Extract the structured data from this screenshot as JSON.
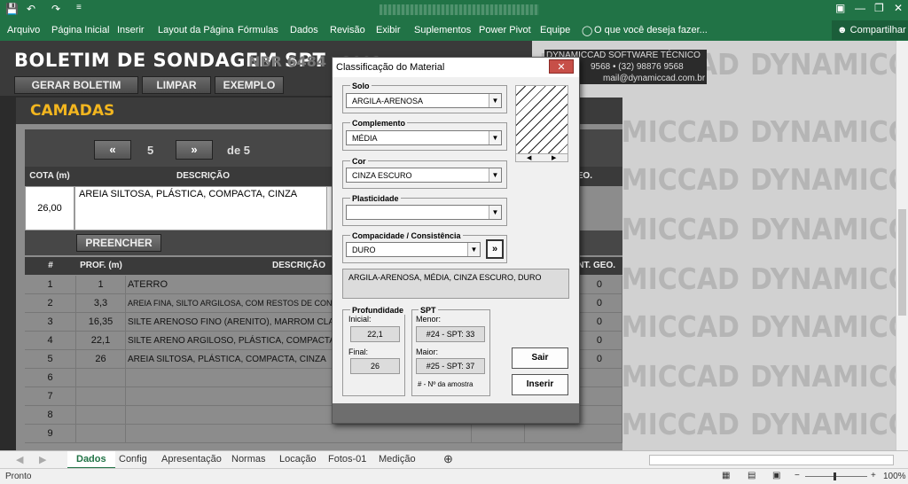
{
  "window": {
    "quick_access": [
      "💾",
      "↶",
      "↷",
      "≡"
    ],
    "controls": [
      "▣",
      "—",
      "❐",
      "✕"
    ]
  },
  "ribbon": {
    "tabs": [
      "Arquivo",
      "Página Inicial",
      "Inserir",
      "Layout da Página",
      "Fórmulas",
      "Dados",
      "Revisão",
      "Exibir",
      "Suplementos",
      "Power Pivot",
      "Equipe"
    ],
    "tell_me": "O que você deseja fazer...",
    "share": "Compartilhar"
  },
  "sheet": {
    "title": "BOLETIM DE SONDAGEM SPT",
    "norm": "NBR 6484 : 2001",
    "company_lines": [
      "DYNAMICCAD SOFTWARE TÉCNICO",
      "9568 • (32) 98876 9568",
      "mail@dynamiccad.com.br"
    ],
    "watermark": "DYNAMICCAD",
    "buttons": {
      "generate": "GERAR BOLETIM",
      "clear": "LIMPAR",
      "example": "EXEMPLO"
    },
    "section_title": "CAMADAS",
    "nav": {
      "prev": "«",
      "current": "5",
      "next": "»",
      "total": "de 5"
    },
    "entry_headers": {
      "cota": "COTA (m)",
      "descricao": "DESCRIÇÃO",
      "geo": "GEO."
    },
    "entry": {
      "cota": "26,00",
      "descricao": "AREIA SILTOSA, PLÁSTICA, COMPACTA, CINZA"
    },
    "fill_button": "PREENCHER",
    "table_headers": {
      "num": "#",
      "prof": "PROF. (m)",
      "descricao": "DESCRIÇÃO",
      "geo": "INT. GEO."
    },
    "rows": [
      {
        "num": "1",
        "prof": "1",
        "desc": "ATERRO",
        "geo": "0"
      },
      {
        "num": "2",
        "prof": "3,3",
        "desc": "AREIA FINA, SILTO ARGILOSA, COM RESTOS DE CONC",
        "geo": "0"
      },
      {
        "num": "3",
        "prof": "16,35",
        "desc": "SILTE ARENOSO FINO (ARENITO), MARROM CLA",
        "geo": "0"
      },
      {
        "num": "4",
        "prof": "22,1",
        "desc": "SILTE ARENO ARGILOSO, PLÁSTICA, COMPACTA",
        "geo": "0"
      },
      {
        "num": "5",
        "prof": "26",
        "desc": "AREIA SILTOSA, PLÁSTICA, COMPACTA, CINZA",
        "geo": "0"
      },
      {
        "num": "6",
        "prof": "",
        "desc": "",
        "geo": ""
      },
      {
        "num": "7",
        "prof": "",
        "desc": "",
        "geo": ""
      },
      {
        "num": "8",
        "prof": "",
        "desc": "",
        "geo": ""
      },
      {
        "num": "9",
        "prof": "",
        "desc": "",
        "geo": ""
      }
    ]
  },
  "dialog": {
    "title": "Classificação do Material",
    "close": "✕",
    "solo_label": "Solo",
    "solo_value": "ARGILA-ARENOSA",
    "complemento_label": "Complemento",
    "complemento_value": "MÉDIA",
    "cor_label": "Cor",
    "cor_value": "CINZA ESCURO",
    "plasticidade_label": "Plasticidade",
    "plasticidade_value": "",
    "compacidade_label": "Compacidade / Consistência",
    "compacidade_value": "DURO",
    "more_button": "»",
    "summary": "ARGILA-ARENOSA, MÉDIA, CINZA ESCURO, DURO",
    "profundidade_label": "Profundidade",
    "inicial_label": "Inicial:",
    "inicial_value": "22,1",
    "final_label": "Final:",
    "final_value": "26",
    "spt_label": "SPT",
    "menor_label": "Menor:",
    "menor_value": "#24 - SPT: 33",
    "maior_label": "Maior:",
    "maior_value": "#25 - SPT: 37",
    "spt_note": "# - Nº da amostra",
    "exit_button": "Sair",
    "insert_button": "Inserir"
  },
  "sheet_tabs": [
    "Dados",
    "Config",
    "Apresentação",
    "Normas",
    "Locação",
    "Fotos-01",
    "Medição"
  ],
  "status": {
    "ready": "Pronto",
    "zoom": "100%"
  }
}
